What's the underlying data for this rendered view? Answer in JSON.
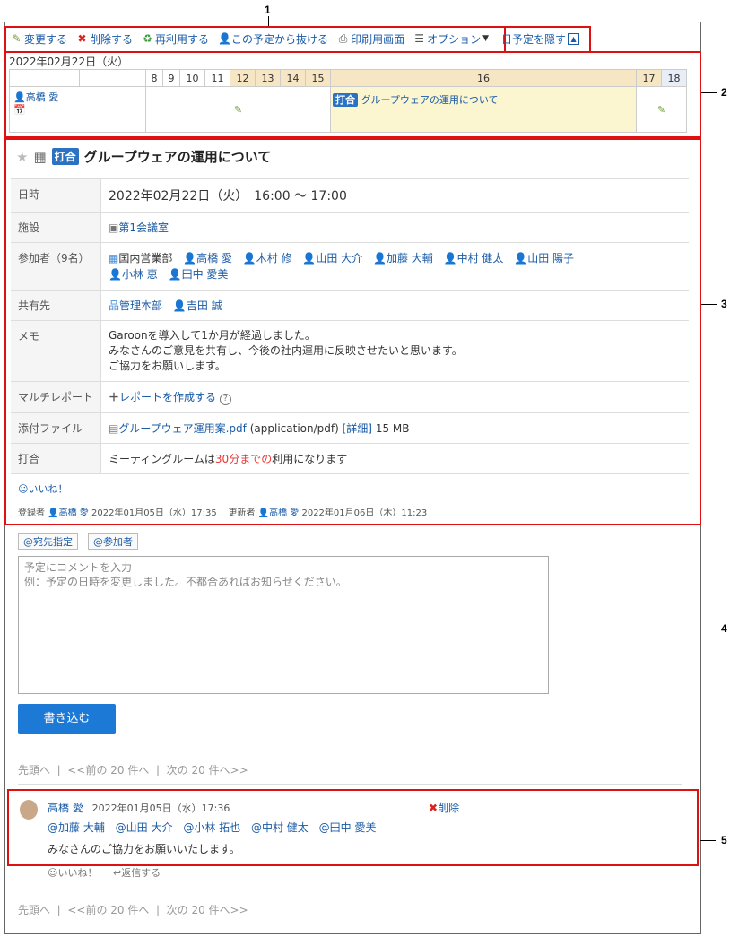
{
  "callouts": [
    "1",
    "2",
    "3",
    "4",
    "5"
  ],
  "toolbar": {
    "edit": "変更する",
    "delete": "削除する",
    "reuse": "再利用する",
    "leave": "この予定から抜ける",
    "print": "印刷用画面",
    "options": "オプション",
    "hide_day": "日予定を隠す"
  },
  "timeline": {
    "date": "2022年02月22日（火）",
    "hours": [
      "8",
      "9",
      "10",
      "11",
      "12",
      "13",
      "14",
      "15",
      "16",
      "17",
      "18"
    ],
    "user": "高橋 愛",
    "event_tag": "打合",
    "event_title": "グループウェアの運用について"
  },
  "detail": {
    "tag": "打合",
    "title": "グループウェアの運用について",
    "rows": {
      "datetime_label": "日時",
      "datetime_value": "2022年02月22日（火）　16:00 〜 17:00",
      "facility_label": "施設",
      "facility_value": "第1会議室",
      "participants_label": "参加者（9名）",
      "participants": [
        "国内営業部",
        "高橋 愛",
        "木村 修",
        "山田 大介",
        "加藤 大輔",
        "中村 健太",
        "山田 陽子",
        "小林 恵",
        "田中 愛美"
      ],
      "share_label": "共有先",
      "share": [
        "管理本部",
        "吉田 誠"
      ],
      "memo_label": "メモ",
      "memo_lines": [
        "Garoonを導入して1か月が経過しました。",
        "みなさんのご意見を共有し、今後の社内運用に反映させたいと思います。",
        "ご協力をお願いします。"
      ],
      "multireport_label": "マルチレポート",
      "multireport_link": "レポートを作成する",
      "attach_label": "添付ファイル",
      "attach_name": "グループウェア運用案.pdf",
      "attach_type": "(application/pdf)",
      "attach_detail": "[詳細]",
      "attach_size": "15 MB",
      "meeting_label": "打合",
      "meeting_pre": "ミーティングルームは",
      "meeting_red": "30分までの",
      "meeting_post": "利用になります"
    },
    "like": "いいね！",
    "registered_label": "登録者",
    "registered_user": "高橋 愛",
    "registered_time": "2022年01月05日（水）17:35",
    "updated_label": "更新者",
    "updated_user": "高橋 愛",
    "updated_time": "2022年01月06日（木）11:23"
  },
  "comment_form": {
    "to_button": "@宛先指定",
    "participants_button": "@参加者",
    "placeholder_line1": "予定にコメントを入力",
    "placeholder_line2": "例：予定の日時を変更しました。不都合あればお知らせください。",
    "submit": "書き込む"
  },
  "pager": {
    "first": "先頭へ",
    "prev": "<<前の 20 件へ",
    "next": "次の 20 件へ>>"
  },
  "comment": {
    "author": "高橋 愛",
    "time": "2022年01月05日（水）17:36",
    "delete": "削除",
    "mentions": [
      "@加藤 大輔",
      "@山田 大介",
      "@小林 拓也",
      "@中村 健太",
      "@田中 愛美"
    ],
    "body": "みなさんのご協力をお願いいたします。",
    "like": "いいね！",
    "reply": "返信する"
  }
}
